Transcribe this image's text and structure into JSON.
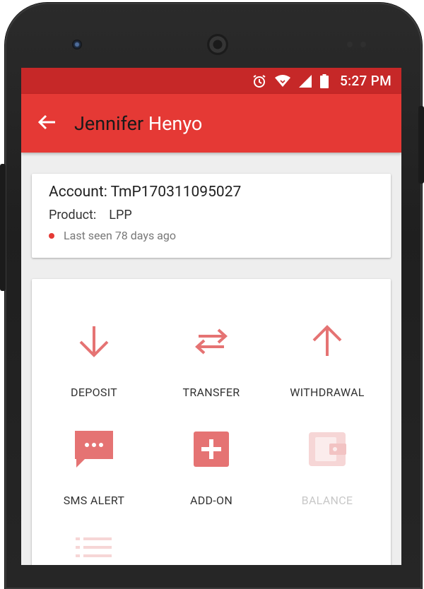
{
  "status_bar": {
    "time": "5:27 PM"
  },
  "app_bar": {
    "title_first": "Jennifer",
    "title_last": "Henyo"
  },
  "account": {
    "account_label": "Account:",
    "account_number": "TmP170311095027",
    "product_label": "Product:",
    "product_value": "LPP",
    "last_seen": "Last seen 78 days ago",
    "status_color": "#e53935"
  },
  "actions": [
    {
      "label": "DEPOSIT",
      "icon": "arrow-down-icon",
      "enabled": true
    },
    {
      "label": "TRANSFER",
      "icon": "transfer-arrows-icon",
      "enabled": true
    },
    {
      "label": "WITHDRAWAL",
      "icon": "arrow-up-icon",
      "enabled": true
    },
    {
      "label": "SMS ALERT",
      "icon": "sms-bubble-icon",
      "enabled": true
    },
    {
      "label": "ADD-ON",
      "icon": "plus-box-icon",
      "enabled": true
    },
    {
      "label": "BALANCE",
      "icon": "wallet-icon",
      "enabled": false
    },
    {
      "label": "",
      "icon": "list-icon",
      "enabled": false
    }
  ],
  "colors": {
    "primary": "#e53935",
    "primary_dark": "#c62828",
    "icon_red": "#e57373"
  }
}
